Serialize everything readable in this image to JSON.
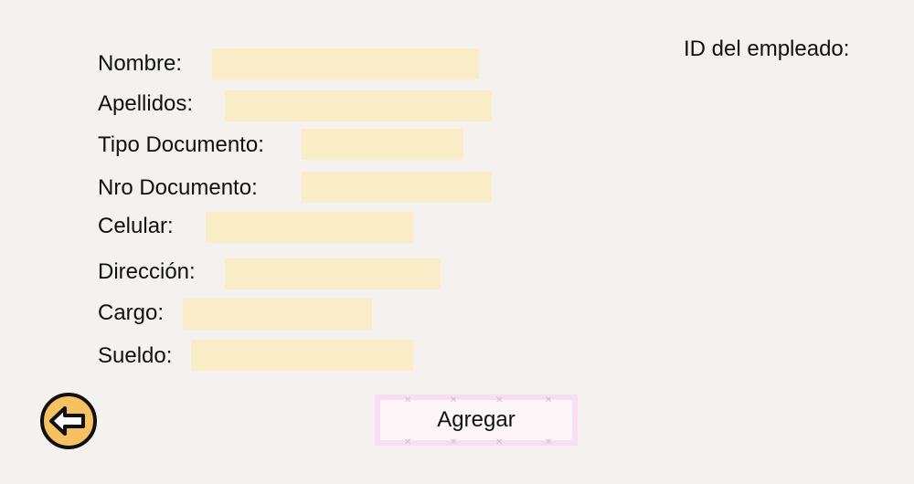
{
  "form": {
    "nombre_label": "Nombre:",
    "apellidos_label": "Apellidos:",
    "tipo_documento_label": "Tipo Documento:",
    "nro_documento_label": "Nro Documento:",
    "celular_label": "Celular:",
    "direccion_label": "Dirección:",
    "cargo_label": "Cargo:",
    "sueldo_label": "Sueldo:"
  },
  "employee": {
    "id_label": "ID del empleado:"
  },
  "actions": {
    "submit_label": "Agregar",
    "back_icon": "arrow-left-icon"
  },
  "colors": {
    "background": "#f5f1ee",
    "field": "#f8edc6",
    "button_border": "#f9def3",
    "back_button": "#f6c160"
  }
}
